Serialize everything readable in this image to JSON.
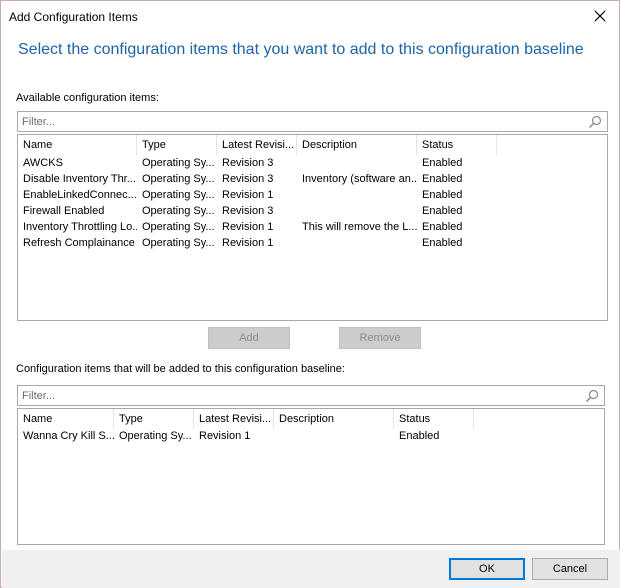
{
  "window": {
    "title": "Add Configuration Items",
    "heading": "Select the configuration items that you want to add to this configuration baseline"
  },
  "available": {
    "label": "Available configuration items:",
    "filter_placeholder": "Filter...",
    "columns": [
      "Name",
      "Type",
      "Latest Revisi...",
      "Description",
      "Status"
    ],
    "rows": [
      [
        "AWCKS",
        "Operating Sy...",
        "Revision 3",
        "",
        "Enabled"
      ],
      [
        "Disable Inventory Thr...",
        "Operating Sy...",
        "Revision 3",
        "Inventory (software an...",
        "Enabled"
      ],
      [
        "EnableLinkedConnec...",
        "Operating Sy...",
        "Revision 1",
        "",
        "Enabled"
      ],
      [
        "Firewall Enabled",
        "Operating Sy...",
        "Revision 3",
        "",
        "Enabled"
      ],
      [
        "Inventory Throttling Lo...",
        "Operating Sy...",
        "Revision 1",
        "This will remove the L...",
        "Enabled"
      ],
      [
        "Refresh Complainance",
        "Operating Sy...",
        "Revision 1",
        "",
        "Enabled"
      ]
    ]
  },
  "actions": {
    "add_label": "Add",
    "remove_label": "Remove"
  },
  "selected": {
    "label": "Configuration items that will be added to this configuration baseline:",
    "filter_placeholder": "Filter...",
    "columns": [
      "Name",
      "Type",
      "Latest Revisi...",
      "Description",
      "Status"
    ],
    "rows": [
      [
        "Wanna Cry Kill S...",
        "Operating Sy...",
        "Revision 1",
        "",
        "Enabled"
      ]
    ]
  },
  "footer": {
    "ok_label": "OK",
    "cancel_label": "Cancel"
  },
  "colors": {
    "heading": "#1d64a8",
    "default_button_border": "#0078d7"
  },
  "icons": [
    "close-icon",
    "search-icon"
  ]
}
